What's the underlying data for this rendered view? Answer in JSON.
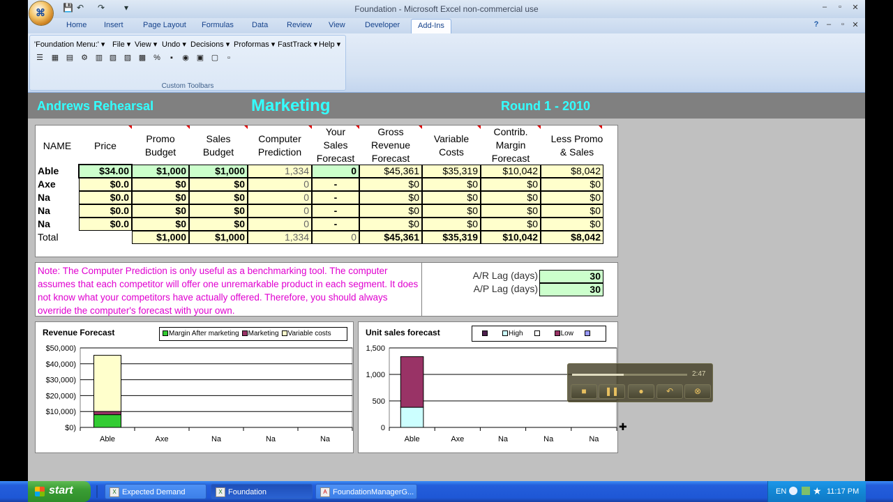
{
  "window": {
    "title": "Foundation  -  Microsoft Excel non-commercial use",
    "office_glyph": "⌘",
    "qat": {
      "save": "💾",
      "undo": "↶",
      "redo": "↷",
      "more": "▾"
    },
    "controls": {
      "minimize": "–",
      "restore": "▫",
      "close": "✕"
    },
    "doc_controls": {
      "help": "?",
      "minimize": "–",
      "restore": "▫",
      "close": "✕"
    }
  },
  "tabs": [
    "Home",
    "Insert",
    "Page Layout",
    "Formulas",
    "Data",
    "Review",
    "View",
    "Developer",
    "Add-Ins"
  ],
  "active_tab": "Add-Ins",
  "ribbon": {
    "menu": [
      "'Foundation Menu:' ▾",
      "File ▾",
      "View ▾",
      "Undo ▾",
      "Decisions ▾",
      "Proformas ▾",
      "FastTrack ▾",
      "Help ▾"
    ],
    "toolbar_icons": [
      "☰",
      "▦",
      "▤",
      "⚙",
      "▥",
      "▧",
      "▨",
      "▩",
      "%",
      "▪",
      "◉",
      "▣",
      "▢",
      "▫"
    ],
    "group_label": "Custom Toolbars"
  },
  "header": {
    "company": "Andrews Rehearsal",
    "section": "Marketing",
    "round": "Round 1 - 2010"
  },
  "table": {
    "headers": {
      "name": "NAME",
      "price": "Price",
      "promo": [
        "Promo",
        "Budget"
      ],
      "sales": [
        "Sales",
        "Budget"
      ],
      "computer": [
        "Computer",
        "Prediction"
      ],
      "your": [
        "Your",
        "Sales",
        "Forecast"
      ],
      "gross": [
        "Gross",
        "Revenue",
        "Forecast"
      ],
      "variable": [
        "Variable",
        "Costs"
      ],
      "contrib": [
        "Contrib.",
        "Margin",
        "Forecast"
      ],
      "less": [
        "Less Promo",
        "& Sales"
      ]
    },
    "rows": [
      {
        "name": "Able",
        "price": "$34.00",
        "promo": "$1,000",
        "sales": "$1,000",
        "computer": "1,334",
        "your": "0",
        "gross": "$45,361",
        "variable": "$35,319",
        "contrib": "$10,042",
        "less": "$8,042"
      },
      {
        "name": "Axe",
        "price": "$0.0",
        "promo": "$0",
        "sales": "$0",
        "computer": "0",
        "your": "-",
        "gross": "$0",
        "variable": "$0",
        "contrib": "$0",
        "less": "$0"
      },
      {
        "name": "Na",
        "price": "$0.0",
        "promo": "$0",
        "sales": "$0",
        "computer": "0",
        "your": "-",
        "gross": "$0",
        "variable": "$0",
        "contrib": "$0",
        "less": "$0"
      },
      {
        "name": "Na",
        "price": "$0.0",
        "promo": "$0",
        "sales": "$0",
        "computer": "0",
        "your": "-",
        "gross": "$0",
        "variable": "$0",
        "contrib": "$0",
        "less": "$0"
      },
      {
        "name": "Na",
        "price": "$0.0",
        "promo": "$0",
        "sales": "$0",
        "computer": "0",
        "your": "-",
        "gross": "$0",
        "variable": "$0",
        "contrib": "$0",
        "less": "$0"
      }
    ],
    "total": {
      "label": "Total",
      "promo": "$1,000",
      "sales": "$1,000",
      "computer": "1,334",
      "your": "0",
      "gross": "$45,361",
      "variable": "$35,319",
      "contrib": "$10,042",
      "less": "$8,042"
    }
  },
  "note": "Note: The Computer Prediction is only useful as a benchmarking tool. The computer assumes that each competitor will offer one unremarkable product in each segment. It does not know what your competitors have actually offered. Therefore, you should always override the computer's forecast with your own.",
  "lags": {
    "ar_label": "A/R Lag (days)",
    "ar_value": "30",
    "ap_label": "A/P Lag (days)",
    "ap_value": "30"
  },
  "colors": {
    "header_text": "#33ffff",
    "note_text": "#e000d0",
    "input_green": "#ccffcc",
    "cell_yellow": "#ffffcc"
  },
  "chart_data": [
    {
      "type": "bar",
      "title": "Revenue Forecast",
      "stacked": true,
      "categories": [
        "Able",
        "Axe",
        "Na",
        "Na",
        "Na"
      ],
      "series": [
        {
          "name": "Margin After marketing",
          "color": "#33cc33",
          "values": [
            8042,
            0,
            0,
            0,
            0
          ]
        },
        {
          "name": "Marketing",
          "color": "#993366",
          "values": [
            2000,
            0,
            0,
            0,
            0
          ]
        },
        {
          "name": "Variable costs",
          "color": "#ffffcc",
          "values": [
            35319,
            0,
            0,
            0,
            0
          ]
        }
      ],
      "ylim": [
        0,
        50000
      ],
      "yticks": [
        "$50,000)",
        "$40,000)",
        "$30,000)",
        "$20,000)",
        "$10,000)",
        "$0)"
      ],
      "grid": true,
      "legend": "top-right"
    },
    {
      "type": "bar",
      "title": "Unit sales forecast",
      "stacked": true,
      "categories": [
        "Able",
        "Axe",
        "Na",
        "Na",
        "Na"
      ],
      "series": [
        {
          "name": "",
          "color": "#4d1f4d",
          "values": [
            0,
            0,
            0,
            0,
            0
          ]
        },
        {
          "name": "High",
          "color": "#ccffff",
          "values": [
            380,
            0,
            0,
            0,
            0
          ]
        },
        {
          "name": "",
          "color": "#ffffff",
          "values": [
            0,
            0,
            0,
            0,
            0
          ]
        },
        {
          "name": "Low",
          "color": "#993366",
          "values": [
            955,
            0,
            0,
            0,
            0
          ]
        },
        {
          "name": "",
          "color": "#9999ff",
          "values": [
            0,
            0,
            0,
            0,
            0
          ]
        }
      ],
      "ylim": [
        0,
        1500
      ],
      "yticks": [
        "1,500",
        "1,000",
        "500",
        "0"
      ],
      "grid": true,
      "legend": "top-right"
    }
  ],
  "media": {
    "time": "2:47",
    "progress": 0.45
  },
  "taskbar": {
    "start": "start",
    "tasks": [
      "Expected Demand",
      "Foundation",
      "FoundationManagerG..."
    ],
    "active_task": "Foundation",
    "tray": {
      "lang": "EN",
      "time": "11:17 PM"
    }
  }
}
